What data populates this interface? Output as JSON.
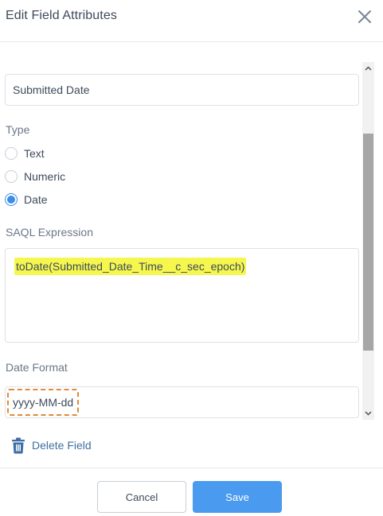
{
  "header": {
    "title": "Edit Field Attributes",
    "close_icon": "close-icon"
  },
  "field": {
    "name_value": "Submitted Date"
  },
  "type_section": {
    "label": "Type",
    "options": [
      {
        "label": "Text",
        "checked": false
      },
      {
        "label": "Numeric",
        "checked": false
      },
      {
        "label": "Date",
        "checked": true
      }
    ]
  },
  "saql_section": {
    "label": "SAQL Expression",
    "expression": "toDate(Submitted_Date_Time__c_sec_epoch)"
  },
  "date_format_section": {
    "label": "Date Format",
    "value": "yyyy-MM-dd"
  },
  "delete_field": {
    "label": "Delete Field",
    "icon": "trash-icon"
  },
  "footer": {
    "cancel_label": "Cancel",
    "save_label": "Save"
  },
  "colors": {
    "accent": "#3a8de8",
    "save_button": "#4a9af0",
    "highlight": "#f5f74e",
    "focus_outline": "#e08a3a",
    "link": "#3e6fa3"
  }
}
